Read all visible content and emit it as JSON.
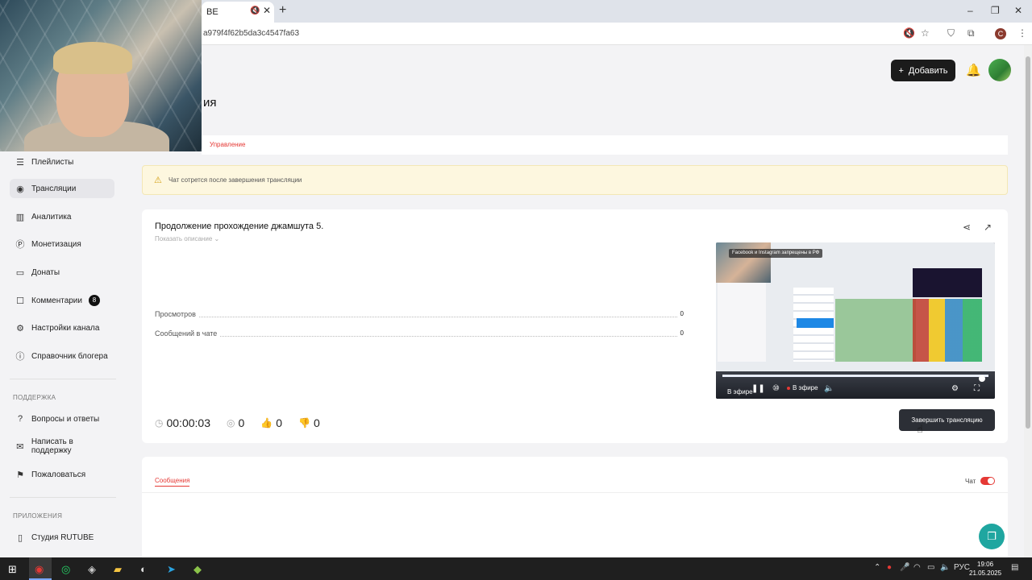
{
  "browser": {
    "tab_title": "BE",
    "url": "a979f4f62b5da3c4547fa63",
    "profile_letter": "C"
  },
  "header": {
    "add_label": "Добавить",
    "page_title_partial": "ия"
  },
  "sidebar": {
    "items": [
      {
        "label": "Плейлисты",
        "icon": "playlist-icon"
      },
      {
        "label": "Трансляции",
        "icon": "broadcast-icon"
      },
      {
        "label": "Аналитика",
        "icon": "analytics-icon"
      },
      {
        "label": "Монетизация",
        "icon": "monetization-icon"
      },
      {
        "label": "Донаты",
        "icon": "donation-icon"
      },
      {
        "label": "Комментарии",
        "icon": "comments-icon",
        "badge": "8"
      },
      {
        "label": "Настройки канала",
        "icon": "settings-icon"
      },
      {
        "label": "Справочник блогера",
        "icon": "help-icon"
      }
    ],
    "support_heading": "ПОДДЕРЖКА",
    "support_items": [
      {
        "label": "Вопросы и ответы"
      },
      {
        "label": "Написать в поддержку"
      },
      {
        "label": "Пожаловаться"
      }
    ],
    "apps_heading": "ПРИЛОЖЕНИЯ",
    "apps_items": [
      {
        "label": "Студия RUTUBE"
      }
    ]
  },
  "tabs": {
    "manage": "Управление"
  },
  "alert": {
    "text": "Чат сотрется после завершения трансляции"
  },
  "stream": {
    "title": "Продолжение прохождение джамшута 5.",
    "show_description": "Показать описание",
    "stats": [
      {
        "label": "Просмотров",
        "value": "0"
      },
      {
        "label": "Сообщений в чате",
        "value": "0"
      }
    ],
    "duration": "00:00:03",
    "viewers": "0",
    "likes": "0",
    "dislikes": "0",
    "end_button": "Завершить трансляцию",
    "player": {
      "banner": "Facebook и Instagram запрещены в РФ",
      "live_label_small": "В эфире",
      "live_label": "В эфире",
      "progress": 1.0
    }
  },
  "chat": {
    "tab_label": "Сообщения",
    "toggle_label": "Чат",
    "toggle_on": true
  },
  "taskbar": {
    "language": "РУС",
    "time": "19:06",
    "date": "21.05.2025"
  },
  "colors": {
    "accent": "#e53935",
    "dark_button": "#1b1b1b",
    "fab": "#1fa6a0",
    "alert_bg": "#fdf7df"
  }
}
